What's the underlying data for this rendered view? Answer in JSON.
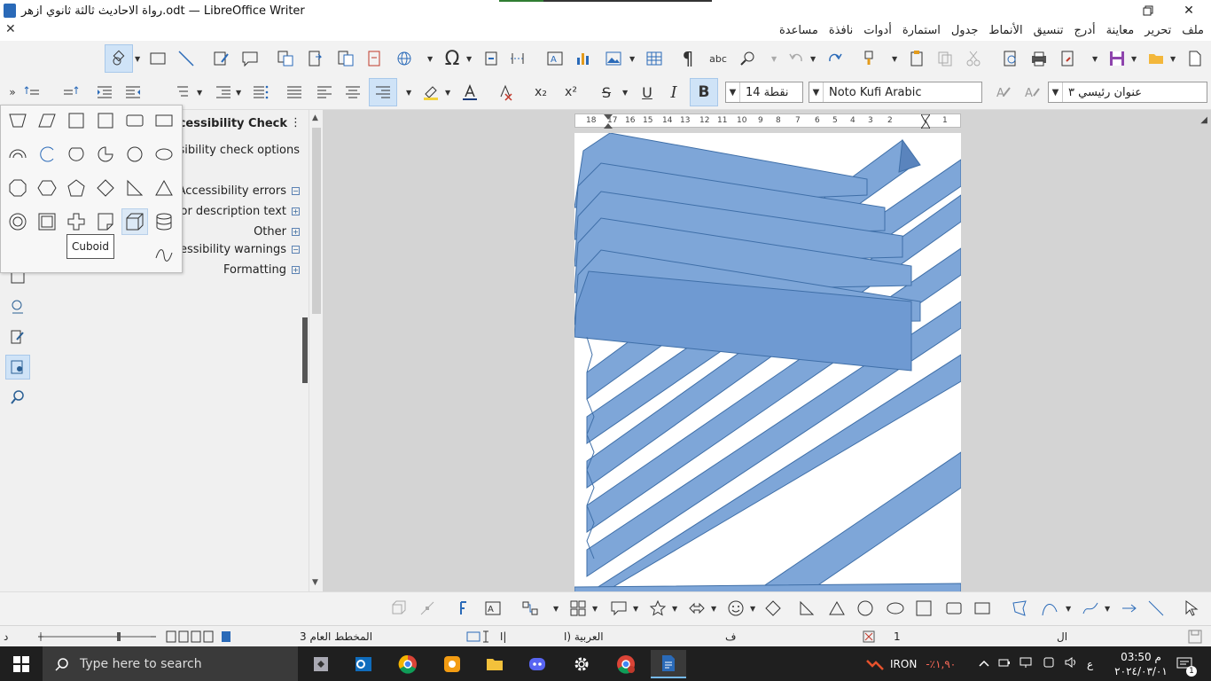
{
  "window": {
    "title": "رواة الاحاديث ثالثة ثانوي ازهر.odt — LibreOffice Writer",
    "restore_symbol": "🗗",
    "close_symbol": "✕",
    "close_doc_symbol": "✕"
  },
  "menu": {
    "items": [
      "ملف",
      "تحرير",
      "معاينة",
      "أدرج",
      "تنسيق",
      "الأنماط",
      "جدول",
      "استمارة",
      "أدوات",
      "نافذة",
      "مساعدة"
    ]
  },
  "formatting": {
    "font_size": "نقطة 14",
    "font_name": "Noto Kufi Arabic",
    "paragraph_style": "عنوان رئيسي ٣",
    "bold_label": "B",
    "italic_label": "I",
    "underline_label": "U",
    "strike_label": "S",
    "subscript_label": "x₂",
    "superscript_label": "x²",
    "spell_label": "abc",
    "pilcrow": "¶",
    "omega": "Ω"
  },
  "sidebar": {
    "title": "Accessibility Check",
    "menu_glyph": "⋮",
    "options_label": "essibility check options",
    "rows": [
      {
        "label": "Accessibility errors",
        "toggle": "−"
      },
      {
        "label": "or description text",
        "toggle": "+"
      },
      {
        "label": "Other",
        "toggle": "+"
      },
      {
        "label": "ccessibility warnings",
        "toggle": "−"
      },
      {
        "label": "Formatting",
        "toggle": "+"
      }
    ]
  },
  "shapes_popup": {
    "tooltip": "Cuboid",
    "selected": "cuboid-shape"
  },
  "ruler": {
    "ticks": [
      "18",
      "17",
      "16",
      "15",
      "14",
      "13",
      "12",
      "11",
      "10",
      "9",
      "8",
      "7",
      "6",
      "5",
      "4",
      "3",
      "2",
      "1"
    ]
  },
  "statusbar": {
    "page_label": "د",
    "page_style": "المخطط العام 3",
    "language": "العربية (ا",
    "lang_short": "ا|",
    "word_label": "ف",
    "page_num": "1",
    "right_letter": "ال"
  },
  "taskbar": {
    "search_placeholder": "Type here to search",
    "iron_label": "IRON",
    "iron_change": "-٪١,٩٠",
    "time": "03:50 م",
    "date": "٢٠٢٤/٠٣/٠١",
    "lang": "ع",
    "notification_count": "1"
  },
  "colors": {
    "accent": "#2a6ab8",
    "shape_fill": "#7ea6d8",
    "shape_stroke": "#3f6fa8",
    "selection": "#cfe3f7"
  }
}
